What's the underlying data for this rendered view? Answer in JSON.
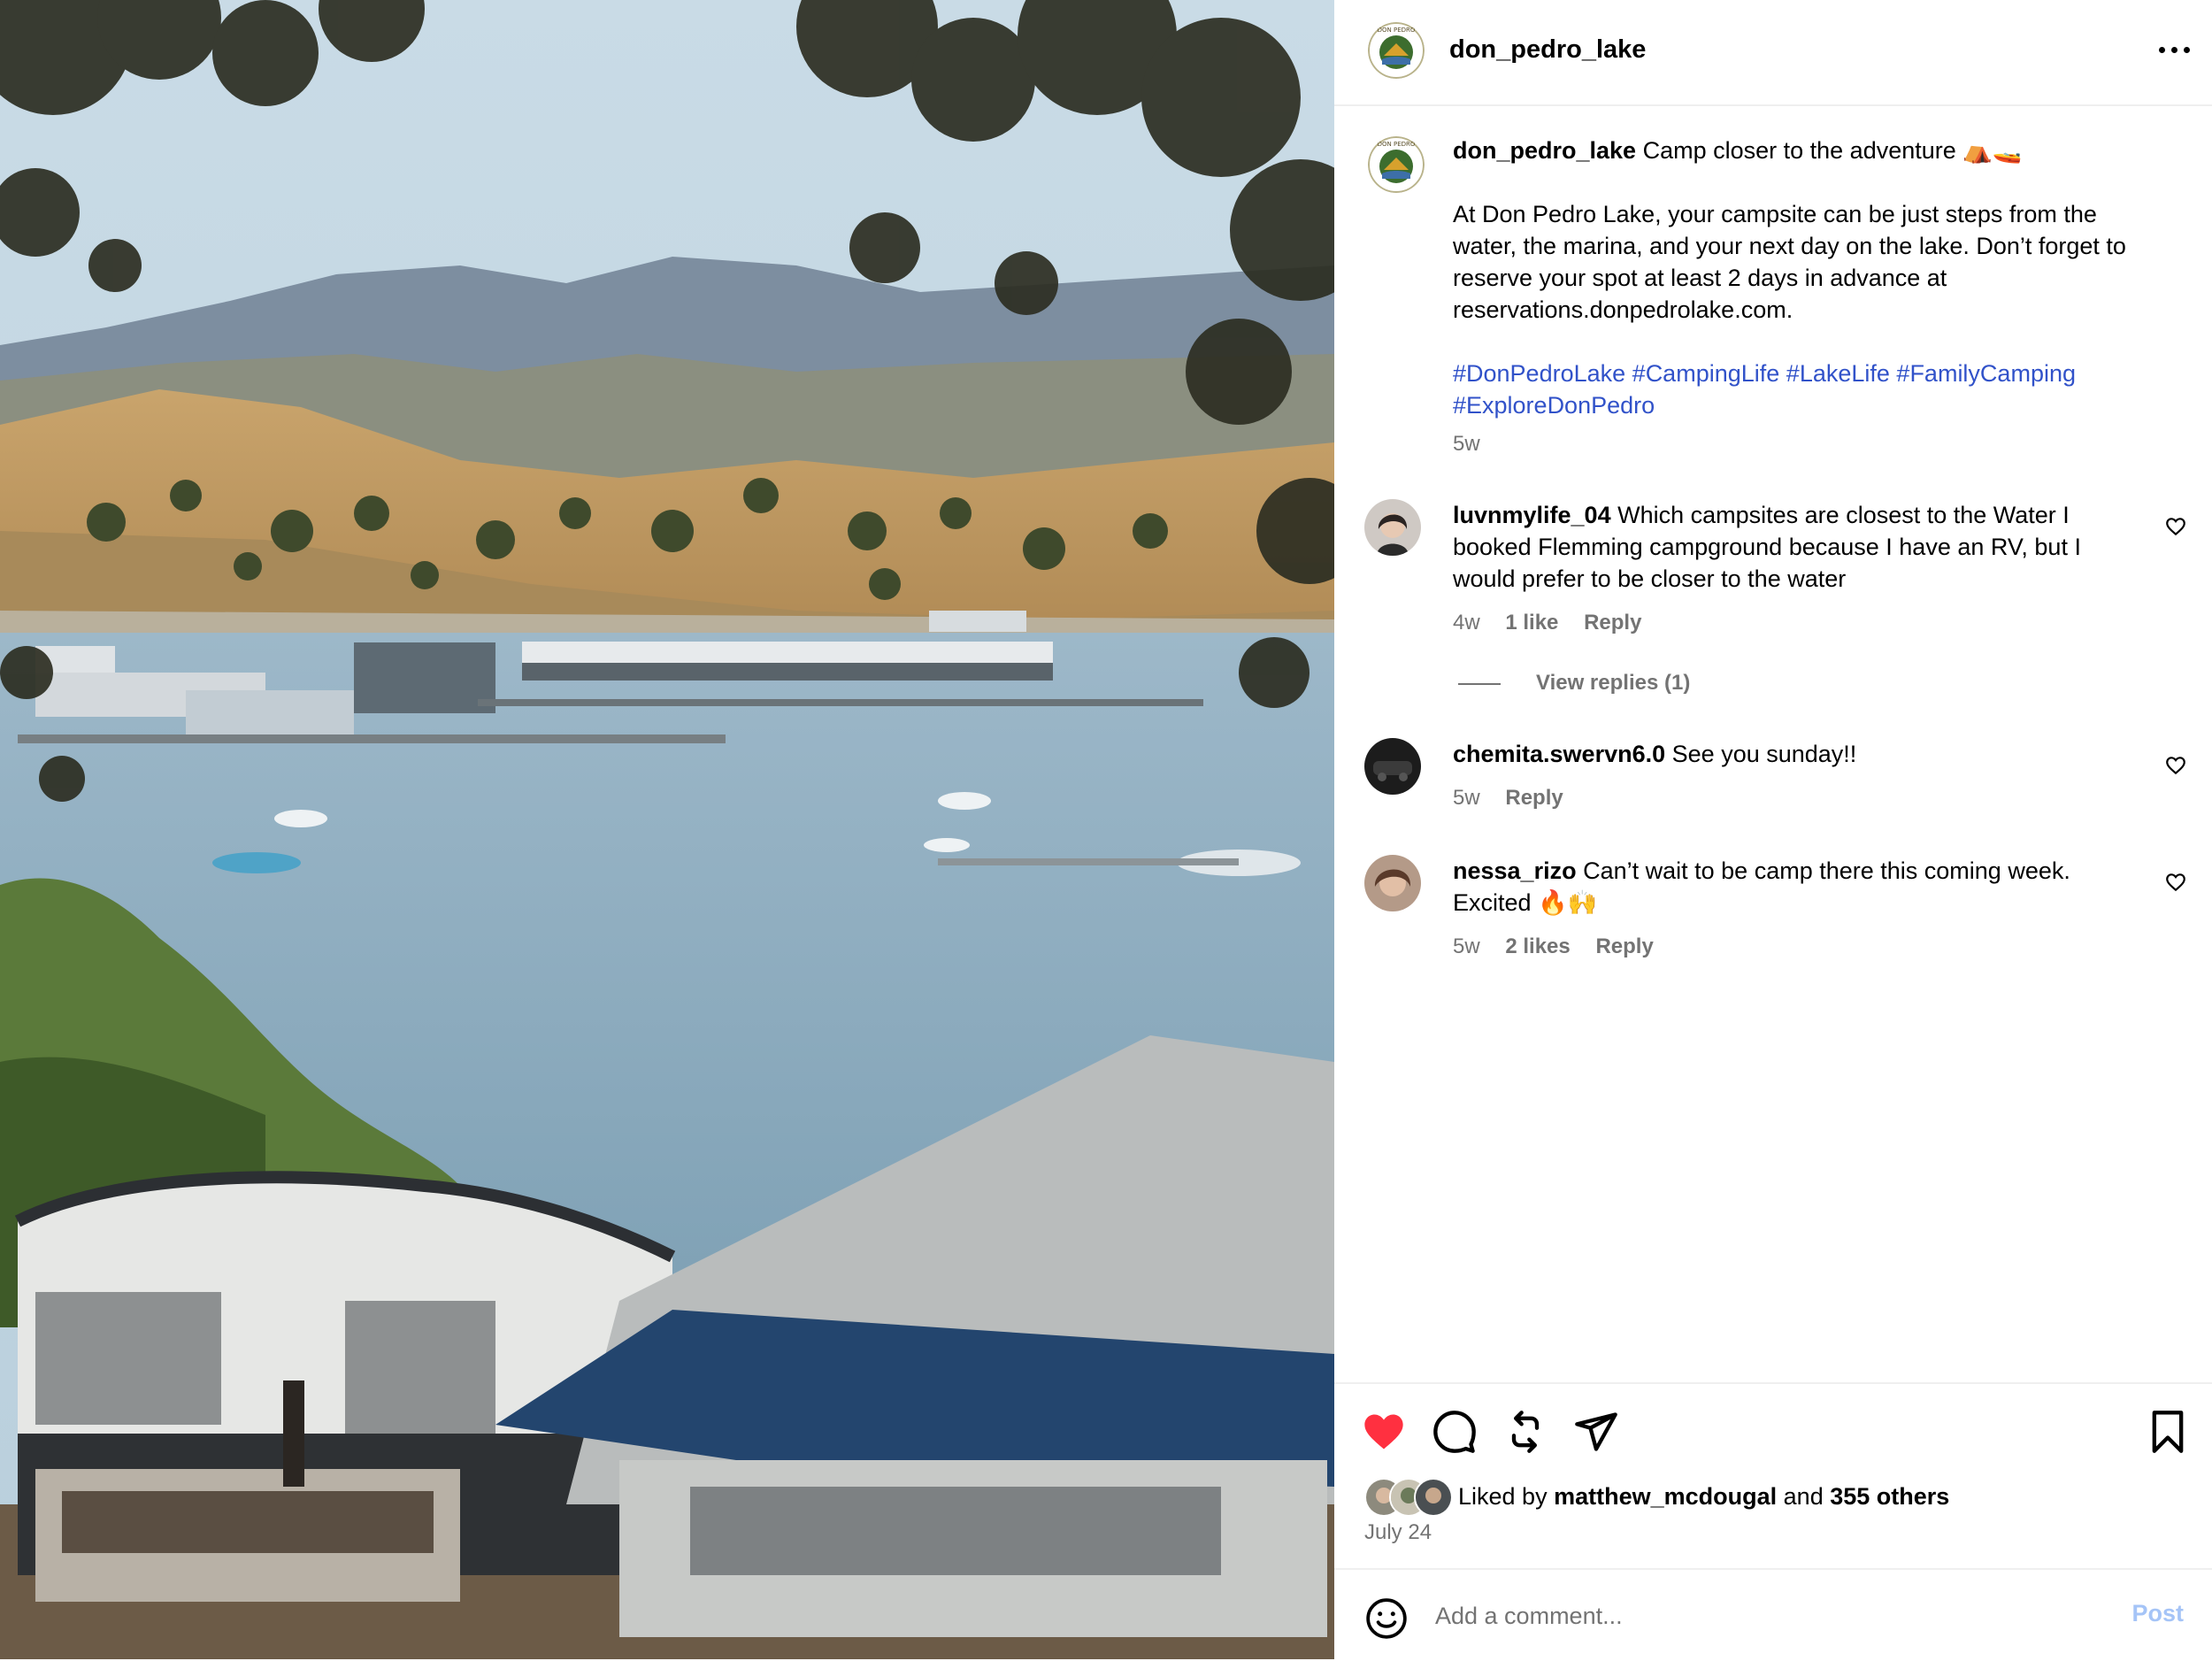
{
  "post": {
    "owner": "don_pedro_lake",
    "logo_text": "DON PEDRO",
    "caption": {
      "username": "don_pedro_lake",
      "title": "Camp closer to the adventure",
      "body": "At Don Pedro Lake, your campsite can be just steps from the water, the marina, and your next day on the lake. Don’t forget to reserve your spot at least 2 days in advance at reservations.donpedrolake.com.",
      "hashtags": [
        "#DonPedroLake",
        "#CampingLife",
        "#LakeLife",
        "#FamilyCamping",
        "#ExploreDonPedro"
      ],
      "time": "5w"
    }
  },
  "comments": [
    {
      "username": "luvnmylife_04",
      "text": "Which campsites are closest to the Water I booked Flemming campground because I have an RV, but I would prefer to be closer to the water",
      "time": "4w",
      "likes": "1 like",
      "reply": "Reply",
      "view_replies": "View replies (1)"
    },
    {
      "username": "chemita.swervn6.0",
      "text": "See you sunday!!",
      "time": "5w",
      "reply": "Reply"
    },
    {
      "username": "nessa_rizo",
      "text": "Can’t wait to be camp there this coming week. Excited 🔥🙌",
      "time": "5w",
      "likes": "2 likes",
      "reply": "Reply"
    }
  ],
  "likes": {
    "prefix": "Liked by",
    "user": "matthew_mcdougal",
    "joiner": "and",
    "others": "355 others"
  },
  "date": "July 24",
  "add_comment": {
    "placeholder": "Add a comment...",
    "post_label": "Post"
  },
  "colors": {
    "like_red": "#ff3040",
    "hashtag_blue": "#3152c9",
    "muted_text": "#737373",
    "post_disabled": "#a5c4f7"
  }
}
